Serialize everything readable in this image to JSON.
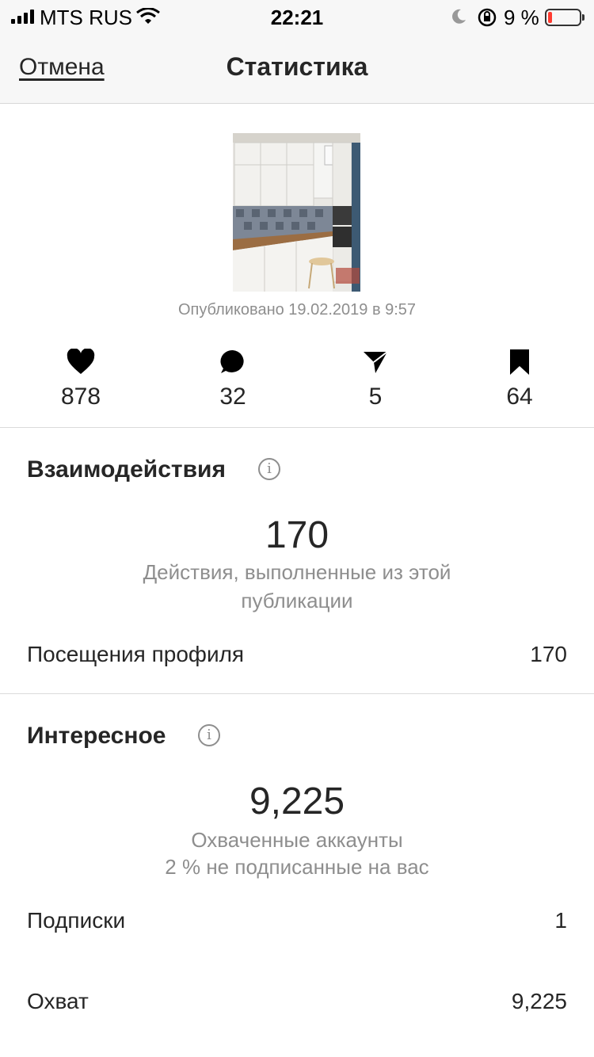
{
  "status": {
    "carrier": "MTS RUS",
    "time": "22:21",
    "battery": "9 %",
    "battery_level": 0.09
  },
  "nav": {
    "cancel": "Отмена",
    "title": "Статистика"
  },
  "post": {
    "published": "Опубликовано 19.02.2019 в 9:57"
  },
  "counters": [
    {
      "icon": "heart-icon",
      "value": "878"
    },
    {
      "icon": "comment-icon",
      "value": "32"
    },
    {
      "icon": "share-icon",
      "value": "5"
    },
    {
      "icon": "bookmark-icon",
      "value": "64"
    }
  ],
  "interactions": {
    "title": "Взаимодействия",
    "total": "170",
    "caption": "Действия, выполненные из этой публикации",
    "rows": [
      {
        "label": "Посещения профиля",
        "value": "170"
      }
    ]
  },
  "discovery": {
    "title": "Интересное",
    "total": "9,225",
    "caption_line1": "Охваченные аккаунты",
    "caption_line2": "2 % не подписанные на вас",
    "rows": [
      {
        "label": "Подписки",
        "value": "1"
      },
      {
        "label": "Охват",
        "value": "9,225"
      }
    ]
  },
  "colors": {
    "text": "#262626",
    "secondary": "#8e8e8e",
    "bar_bg": "#f7f7f7",
    "battery_low": "#ff3b30"
  }
}
